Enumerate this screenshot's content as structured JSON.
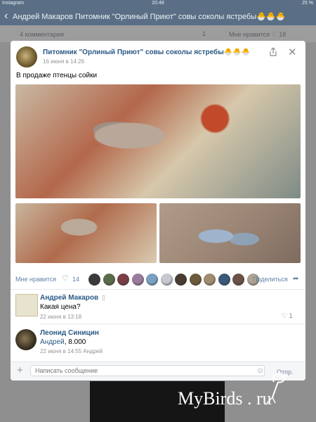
{
  "statusbar": {
    "app": "Instagram",
    "time": "20:48",
    "battery": "25 %"
  },
  "navbar": {
    "back_symbol": "‹",
    "title": "Андрей Макаров  Питомник \"Орлиный Приют\" совы соколы ястребы🐣🐣🐣"
  },
  "background_post": {
    "comments": "4 комментария",
    "shares": "1",
    "likes_label": "Мне нравится",
    "likes": "18"
  },
  "post": {
    "author": "Питомник \"Орлиный Приют\" совы соколы ястребы🐣🐣🐣",
    "date": "16 июня в 14:26",
    "text": "В продаже птенцы сойки",
    "likes_label": "Мне нравится",
    "likes_count": "14",
    "share_label": "Поделиться",
    "liker_colors": [
      "#3a3a3a",
      "#5a6b4a",
      "#7a3f45",
      "#9b7b9b",
      "#7aa0c4",
      "#c5c9cf",
      "#4a3c32",
      "#6d5a3c",
      "#a08c6f",
      "#3b5a7a",
      "#6a5246",
      "#b0a393"
    ]
  },
  "comments": [
    {
      "name": "Андрей Макаров",
      "has_phone_icon": true,
      "text": "Какая цена?",
      "date": "22 июня в 13:18",
      "likes": "1"
    },
    {
      "name": "Леонид Синицин",
      "mention": "Андрей",
      "text": ", 8.000",
      "date": "22 июня в 14:55 Андрей"
    }
  ],
  "composer": {
    "placeholder": "Написать сообщение",
    "send_label": "Отпр."
  },
  "watermark": "MyBirds . ru",
  "colors": {
    "link": "#2a5885",
    "navbar": "#5a6f86",
    "accent_blue": "#5e81a8"
  }
}
